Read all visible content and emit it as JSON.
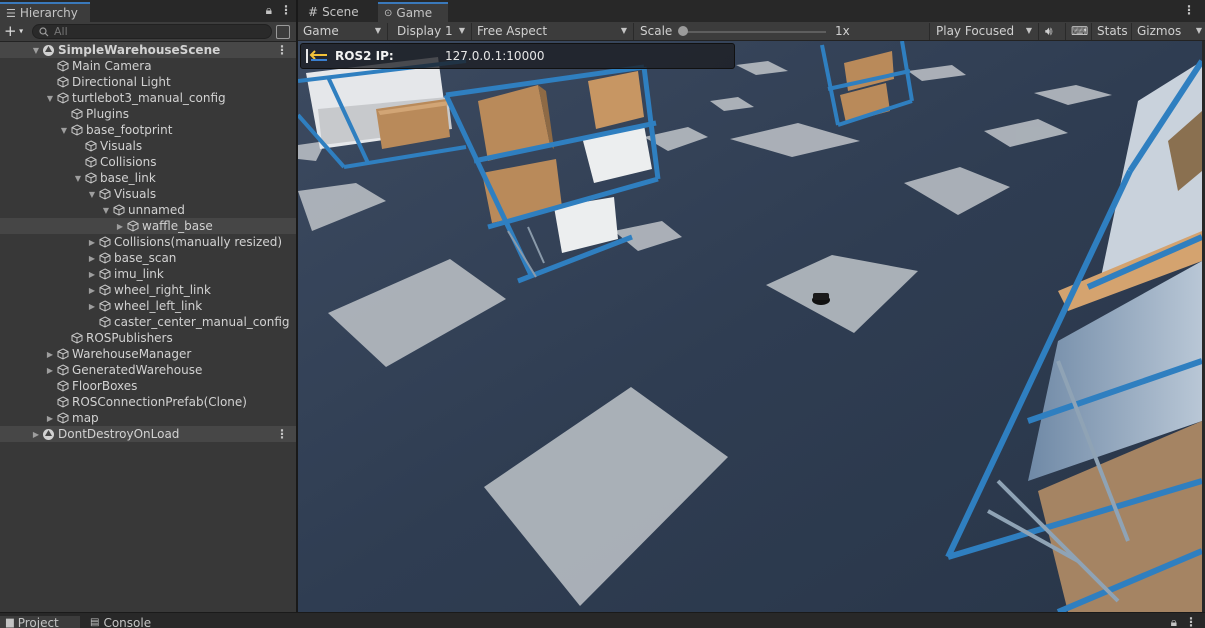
{
  "hierarchy": {
    "tab_label": "Hierarchy",
    "search_placeholder": "All",
    "scene_name": "SimpleWarehouseScene",
    "items": [
      {
        "label": "Main Camera"
      },
      {
        "label": "Directional Light"
      },
      {
        "label": "turtlebot3_manual_config"
      },
      {
        "label": "Plugins"
      },
      {
        "label": "base_footprint"
      },
      {
        "label": "Visuals"
      },
      {
        "label": "Collisions"
      },
      {
        "label": "base_link"
      },
      {
        "label": "Visuals"
      },
      {
        "label": "unnamed"
      },
      {
        "label": "waffle_base"
      },
      {
        "label": "Collisions(manually resized)"
      },
      {
        "label": "base_scan"
      },
      {
        "label": "imu_link"
      },
      {
        "label": "wheel_right_link"
      },
      {
        "label": "wheel_left_link"
      },
      {
        "label": "caster_center_manual_config"
      },
      {
        "label": "ROSPublishers"
      },
      {
        "label": "WarehouseManager"
      },
      {
        "label": "GeneratedWarehouse"
      },
      {
        "label": "FloorBoxes"
      },
      {
        "label": "ROSConnectionPrefab(Clone)"
      },
      {
        "label": "map"
      }
    ],
    "dont_destroy": "DontDestroyOnLoad"
  },
  "game_view": {
    "tabs": [
      {
        "label": "Scene"
      },
      {
        "label": "Game"
      }
    ],
    "toolbar": {
      "mode": "Game",
      "display": "Display 1",
      "aspect": "Free Aspect",
      "scale_label": "Scale",
      "scale_value": "1x",
      "play_mode": "Play Focused",
      "stats": "Stats",
      "gizmos": "Gizmos"
    },
    "ros_overlay": {
      "label": "ROS2 IP:",
      "value": "127.0.0.1:10000"
    }
  },
  "bottom_tabs": [
    {
      "label": "Project"
    },
    {
      "label": "Console"
    }
  ],
  "colors": {
    "accent": "#3a79bb",
    "floor": "#2f3d52",
    "rack": "#2f7fc0",
    "box_cardboard": "#b98a5a",
    "box_white": "#e5e7ea"
  }
}
